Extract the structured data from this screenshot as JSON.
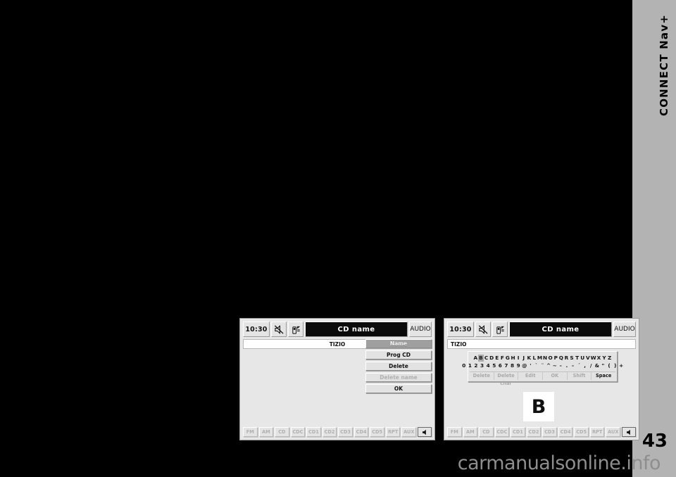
{
  "page": {
    "manual_title": "CONNECT Nav+",
    "page_number": "43",
    "watermark": "carmanualsonline.info"
  },
  "screens": [
    {
      "id": "cd-name-list",
      "statusbar": {
        "clock": "10:30",
        "icons": [
          "mute-crossed-speaker-icon",
          "phone-signal-icon"
        ],
        "title": "CD name",
        "source_label": "AUDIO"
      },
      "name_field": {
        "value": "TIZIO",
        "align": "center"
      },
      "buttons": [
        {
          "label": "Name",
          "state": "selected"
        },
        {
          "label": "Prog CD",
          "state": "normal"
        },
        {
          "label": "Delete",
          "state": "normal"
        },
        {
          "label": "Delete name",
          "state": "disabled"
        },
        {
          "label": "OK",
          "state": "normal"
        }
      ],
      "tabs": [
        "FM",
        "AM",
        "CD",
        "CDC",
        "CD1",
        "CD2",
        "CD3",
        "CD4",
        "CD5",
        "RPT",
        "AUX"
      ],
      "speaker_tab": "speaker-icon"
    },
    {
      "id": "cd-name-edit",
      "statusbar": {
        "clock": "10:30",
        "icons": [
          "mute-crossed-speaker-icon",
          "phone-signal-icon"
        ],
        "title": "CD name",
        "source_label": "AUDIO"
      },
      "name_field": {
        "value": "TIZIO",
        "align": "left"
      },
      "keyboard": {
        "row1": [
          "A",
          "B",
          "C",
          "D",
          "E",
          "F",
          "G",
          "H",
          "I",
          "J",
          "K",
          "L",
          "M",
          "N",
          "O",
          "P",
          "Q",
          "R",
          "S",
          "T",
          "U",
          "V",
          "W",
          "X",
          "Y",
          "Z"
        ],
        "row2": [
          "0",
          "1",
          "2",
          "3",
          "4",
          "5",
          "6",
          "7",
          "8",
          "9",
          "@",
          "'",
          "`",
          "¨",
          "^",
          "~",
          "-",
          ".",
          "-",
          "´",
          ",",
          "/",
          "&",
          "\"",
          "(",
          ")",
          "+"
        ],
        "cursor_index": 1,
        "cursor_char": "B",
        "actions": [
          {
            "label": "Delete",
            "state": "disabled"
          },
          {
            "label": "Delete char",
            "state": "disabled"
          },
          {
            "label": "Edit",
            "state": "disabled"
          },
          {
            "label": "OK",
            "state": "disabled"
          },
          {
            "label": "Shift",
            "state": "disabled"
          },
          {
            "label": "Space",
            "state": "active"
          }
        ]
      },
      "preview_char": "B",
      "tabs": [
        "FM",
        "AM",
        "CD",
        "CDC",
        "CD1",
        "CD2",
        "CD3",
        "CD4",
        "CD5",
        "RPT",
        "AUX"
      ],
      "speaker_tab": "speaker-icon"
    }
  ],
  "colors": {
    "page_background": "#000000",
    "sidebar": "#b3b3b3",
    "screen_background": "#e7e7e7",
    "title_bar": "#0b0b0b",
    "selected_button": "#9f9f9f"
  }
}
